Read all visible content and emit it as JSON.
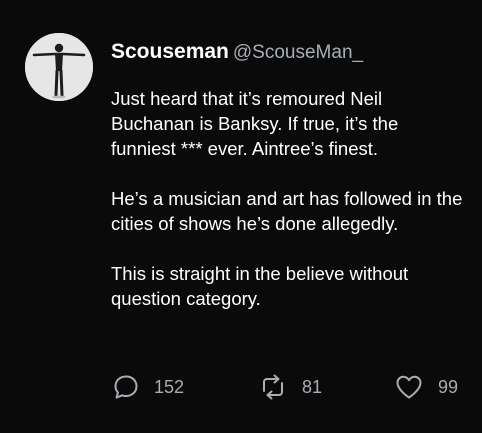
{
  "tweet": {
    "author": {
      "display_name": "Scouseman",
      "handle": "@ScouseMan_"
    },
    "paragraphs": [
      "Just heard that it’s remoured Neil Buchanan is Banksy. If true, it’s the funniest *** ever. Aintree’s finest.",
      "He’s a musician and art has followed in the cities of shows he’s done allegedly.",
      "This is straight in the believe without question category."
    ],
    "stats": {
      "replies": "152",
      "retweets": "81",
      "likes": "99"
    }
  },
  "icons": {
    "reply": "speech-bubble-icon",
    "retweet": "retweet-arrows-icon",
    "like": "heart-icon"
  },
  "colors": {
    "background": "#0a0a0b",
    "text": "#ffffff",
    "secondary_text": "#a8aeb4"
  }
}
